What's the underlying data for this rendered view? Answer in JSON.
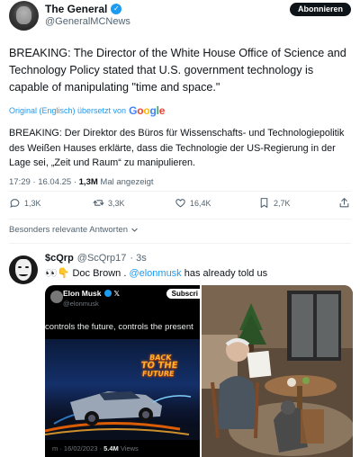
{
  "tweet": {
    "display_name": "The General",
    "handle": "@GeneralMCNews",
    "follow_label": "Abonnieren",
    "text": "BREAKING: The Director of the White House Office of Science and Technology Policy stated that U.S. government technology is capable of manipulating \"time and space.\"",
    "translation_label": "Original (Englisch) übersetzt von",
    "translated_text": "BREAKING: Der Direktor des Büros für Wissenschafts- und Technologiepolitik des Weißen Hauses erklärte, dass die Technologie der US-Regierung in der Lage sei, „Zeit und Raum“ zu manipulieren.",
    "time": "17:29 · 16.04.25 ·",
    "views_count": "1,3M",
    "views_label": "Mal angezeigt",
    "stats": {
      "replies": "1,3K",
      "retweets": "3,3K",
      "likes": "16,4K",
      "bookmarks": "2,7K"
    },
    "replies_sort_label": "Besonders relevante Antworten"
  },
  "reply": {
    "display_name": "$cQrp",
    "handle": "@ScQrp17",
    "time": "· 3s",
    "text_emoji": "👀👇",
    "text_before": "Doc Brown . ",
    "mention": "@elonmusk",
    "text_after": " has already told us"
  },
  "embedded_post": {
    "name": "Elon Musk",
    "handle": "@elonmusk",
    "subscribe_label": "Subscri",
    "quote": "controls the future, controls the present",
    "movie_title": {
      "line1": "BACK",
      "line2": "TO THE",
      "line3": "FUTURE"
    },
    "footer_date": "m · 16/02/2023 ·",
    "footer_views": "5.4M",
    "footer_views_label": "Views"
  },
  "colors": {
    "accent": "#1d9bf0",
    "text": "#0f1419",
    "secondary": "#536471",
    "verified": "#1d9bf0"
  },
  "icons": [
    "verified-badge-icon",
    "reply-icon",
    "retweet-icon",
    "like-icon",
    "bookmark-icon",
    "share-icon",
    "chevron-down-icon",
    "google-logo",
    "x-logo-icon"
  ]
}
